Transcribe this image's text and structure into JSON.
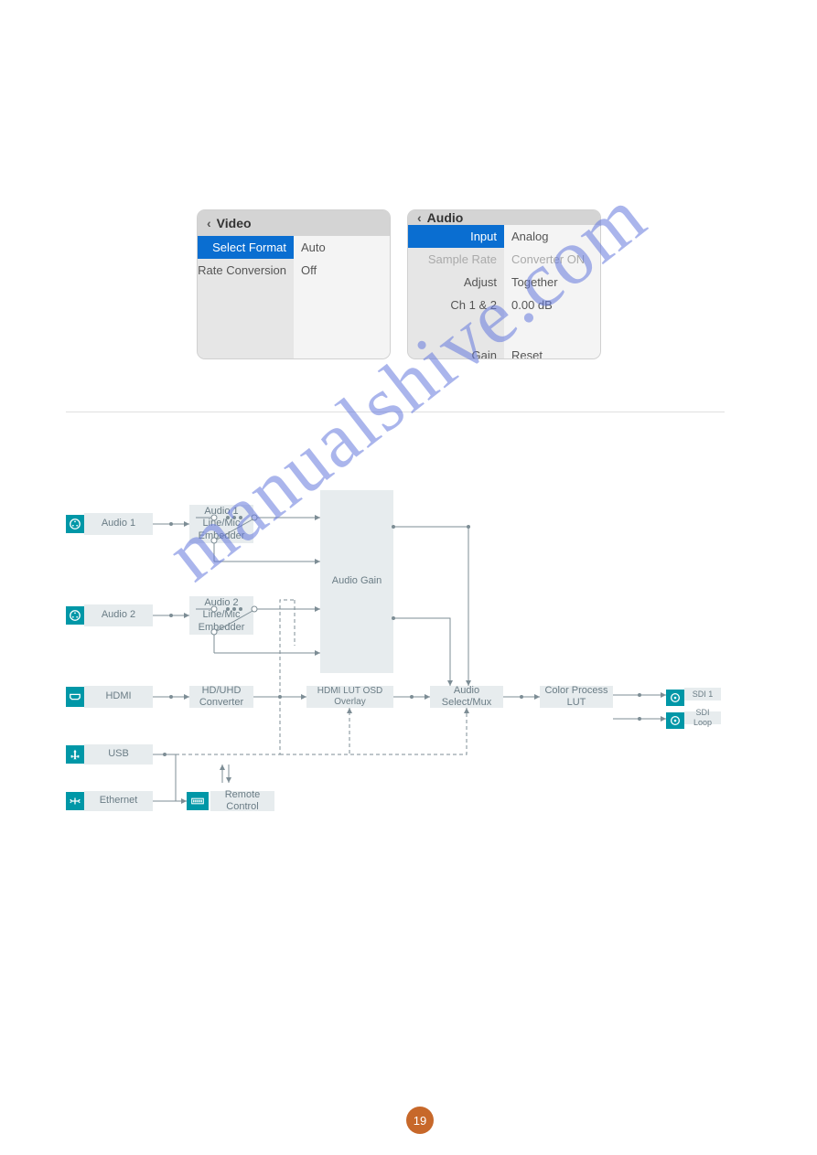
{
  "page_number": "19",
  "watermark": "manualshive.com",
  "video_panel": {
    "title": "Video",
    "rows": [
      {
        "label": "Select Format",
        "value": "Auto",
        "selected": true
      },
      {
        "label": "Rate Conversion",
        "value": "Off"
      }
    ]
  },
  "audio_panel": {
    "title": "Audio",
    "rows": [
      {
        "label": "Input",
        "value": "Analog",
        "selected": true
      },
      {
        "label": "Sample Rate",
        "value": "Converter ON",
        "muted": true
      },
      {
        "label": "Adjust",
        "value": "Together"
      },
      {
        "label": "Ch 1 & 2",
        "value": "0.00 dB"
      }
    ],
    "footer": {
      "label": "Gain",
      "value": "Reset"
    }
  },
  "diagram": {
    "inputs": {
      "audio1": "Audio 1",
      "audio2": "Audio 2",
      "hdmi": "HDMI",
      "usb": "USB",
      "ethernet": "Ethernet"
    },
    "blocks": {
      "emb1": "Audio 1 Line/Mic Embedder",
      "emb2": "Audio 2 Line/Mic Embedder",
      "audio_gain": "Audio Gain",
      "hdmi_conv": "HD/UHD Converter",
      "remote": "Remote Control",
      "hdmi_overlay": "HDMI LUT OSD Overlay",
      "audio_mux": "Audio Select/Mux",
      "color_process": "Color Process LUT",
      "sdi_out": "SDI 1",
      "sdi_loop": "SDI Loop"
    }
  }
}
